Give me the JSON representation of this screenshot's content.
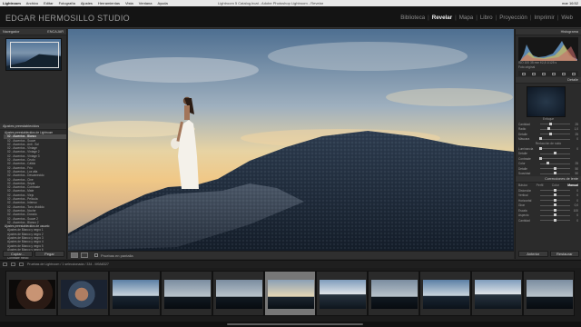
{
  "menubar": {
    "app": "Lightroom",
    "items": [
      "Archivo",
      "Editar",
      "Fotografía",
      "Ajustes",
      "Herramientas",
      "Vista",
      "Ventana",
      "Ayuda"
    ],
    "window_title": "Lightroom 5 Catalog.lrcat - Adobe Photoshop Lightroom - Revelar",
    "clock": "mar 16:52"
  },
  "identity": {
    "plate": "EDGAR HERMOSILLO STUDIO",
    "modules": [
      "Biblioteca",
      "Revelar",
      "Mapa",
      "Libro",
      "Proyección",
      "Imprimir",
      "Web"
    ],
    "active_module": "Revelar"
  },
  "left_panel": {
    "navigator_title": "Navegador",
    "navigator_zoom": "ENCAJAR",
    "presets_title": "Ajustes preestablecidos",
    "presets": [
      "Ajustes preestablecidos de Lightroom",
      "02 - Ascentos - Blanco",
      "02 - Ascentos - Suave",
      "02 - Ascentos - Anti - Sol",
      "02 - Ascentos - Vintage",
      "02 - Ascentos - Vintage 2",
      "02 - Ascentos - Vintage 3",
      "02 - Ascentos - Crudo",
      "02 - Ascentos - Cálido",
      "02 - Ascentos - Frío",
      "02 - Ascentos - Luz alta",
      "02 - Ascentos - Desvanecido",
      "02 - Ascentos - Cine",
      "02 - Ascentos - Sepia",
      "02 - Ascentos - Contraste",
      "02 - Ascentos - Mate",
      "02 - Ascentos - Viejo",
      "02 - Ascentos - Película",
      "02 - Ascentos - Intenso",
      "02 - Ascentos - Tono dividido",
      "02 - Ascentos - Noche",
      "02 - Ascentos - Dorado",
      "02 - Ascentos - Suave 2",
      "02 - Ascentos - Blanco 2",
      "Ajustes preestablecidos de usuario",
      "Ajustes de Blanco y negro 1",
      "Ajustes de Blanco y negro 2",
      "Ajustes de Blanco y negro 3",
      "Ajustes de Blanco y negro 4",
      "Ajustes de Blanco y negro 5",
      "Ajustes de Blanco y negro 6",
      "Contraste alto",
      "Contraste medio",
      "Ajustes preestablecidos usuario 2",
      "Cálido",
      "Enfoque suave"
    ],
    "selected_preset_index": 1,
    "copy_button": "Copiar...",
    "paste_button": "Pegar"
  },
  "toolbar": {
    "label": "Pruebas en pantalla"
  },
  "right_panel": {
    "histogram_title": "Histograma",
    "histogram_info": "ISO 100   35 mm   f/2,8   1/125 s",
    "original_label": "Foto original",
    "detail_title": "Detalle",
    "sharpen_title": "Enfoque",
    "sharpen_sliders": [
      {
        "label": "Cantidad",
        "value": "25",
        "pos": 0.35
      },
      {
        "label": "Radio",
        "value": "1,0",
        "pos": 0.3
      },
      {
        "label": "Detalle",
        "value": "25",
        "pos": 0.35
      },
      {
        "label": "Máscara",
        "value": "0",
        "pos": 0.0
      }
    ],
    "noise_title": "Reducción de ruido",
    "noise_sliders": [
      {
        "label": "Luminancia",
        "value": "0",
        "pos": 0.0
      },
      {
        "label": "Detalle",
        "value": "",
        "pos": 0.5
      },
      {
        "label": "Contraste",
        "value": "",
        "pos": 0.0
      },
      {
        "label": "Color",
        "value": "25",
        "pos": 0.25
      },
      {
        "label": "Detalle",
        "value": "50",
        "pos": 0.5
      },
      {
        "label": "Suavidad",
        "value": "50",
        "pos": 0.5
      }
    ],
    "lens_title": "Correcciones de lente",
    "calib_tabs": [
      "Básico",
      "Perfil",
      "Color",
      "Manual"
    ],
    "calib_active": "Manual",
    "calib_sliders": [
      {
        "label": "Distorsión",
        "value": "0",
        "pos": 0.5
      },
      {
        "label": "Vertical",
        "value": "0",
        "pos": 0.5
      },
      {
        "label": "Horizontal",
        "value": "0",
        "pos": 0.5
      },
      {
        "label": "Girar",
        "value": "0,0",
        "pos": 0.5
      },
      {
        "label": "Escala",
        "value": "100",
        "pos": 0.5
      },
      {
        "label": "Aspecto",
        "value": "0",
        "pos": 0.5
      },
      {
        "label": "Cantidad",
        "value": "0",
        "pos": 0.5
      }
    ],
    "previous_button": "Anterior",
    "reset_button": "Restaurar"
  },
  "filmstrip": {
    "info": "Pruebas de Lightroom  /  1 seleccionada  /  334 - M9A8327",
    "thumb_count": 11,
    "selected_index": 5
  },
  "colors": {
    "background": "#262626",
    "active_module": "#f0f0f0",
    "panel": "#2b2b2b"
  }
}
